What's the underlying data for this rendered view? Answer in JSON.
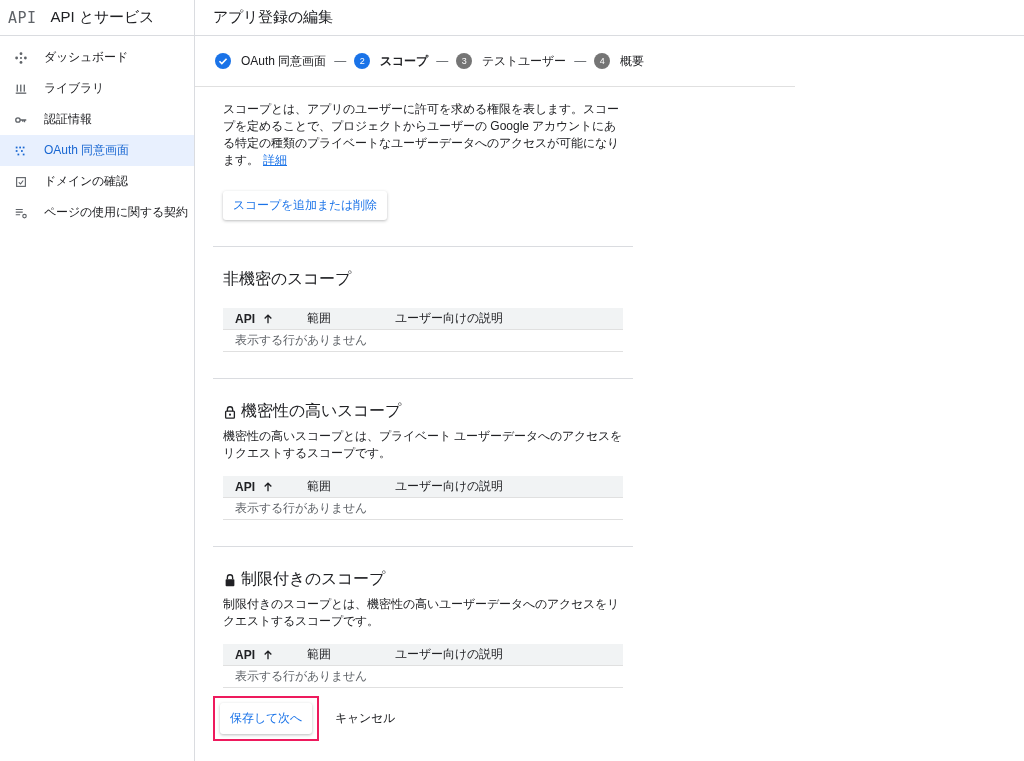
{
  "sidebar": {
    "logo": "API",
    "title": "API とサービス",
    "items": [
      {
        "label": "ダッシュボード",
        "selected": false
      },
      {
        "label": "ライブラリ",
        "selected": false
      },
      {
        "label": "認証情報",
        "selected": false
      },
      {
        "label": "OAuth 同意画面",
        "selected": true
      },
      {
        "label": "ドメインの確認",
        "selected": false
      },
      {
        "label": "ページの使用に関する契約",
        "selected": false
      }
    ]
  },
  "page": {
    "title": "アプリ登録の編集"
  },
  "stepper": [
    {
      "label": "OAuth 同意画面",
      "completed": true,
      "selected": false
    },
    {
      "number": "2",
      "label": "スコープ",
      "completed": false,
      "selected": true
    },
    {
      "number": "3",
      "label": "テストユーザー",
      "completed": false,
      "selected": false
    },
    {
      "number": "4",
      "label": "概要",
      "completed": false,
      "selected": false
    }
  ],
  "step_separator": "—",
  "intro": {
    "text": "スコープとは、アプリのユーザーに許可を求める権限を表します。スコープを定めることで、プロジェクトからユーザーの Google アカウントにある特定の種類のプライベートなユーザーデータへのアクセスが可能になります。",
    "link": "詳細"
  },
  "add_scopes_button": "スコープを追加または削除",
  "sections": [
    {
      "kind": "public",
      "title": "非機密のスコープ",
      "columns": [
        "API",
        "範囲",
        "ユーザー向けの説明"
      ],
      "empty_text": "表示する行がありません"
    },
    {
      "kind": "sensitive",
      "title": "機密性の高いスコープ",
      "description": "機密性の高いスコープとは、プライベート ユーザーデータへのアクセスをリクエストするスコープです。",
      "columns": [
        "API",
        "範囲",
        "ユーザー向けの説明"
      ],
      "empty_text": "表示する行がありません"
    },
    {
      "kind": "restricted",
      "title": "制限付きのスコープ",
      "description": "制限付きのスコープとは、機密性の高いユーザーデータへのアクセスをリクエストするスコープです。",
      "columns": [
        "API",
        "範囲",
        "ユーザー向けの説明"
      ],
      "empty_text": "表示する行がありません"
    }
  ],
  "actions": {
    "save": "保存して次へ",
    "save_highlighted": true,
    "cancel": "キャンセル"
  }
}
